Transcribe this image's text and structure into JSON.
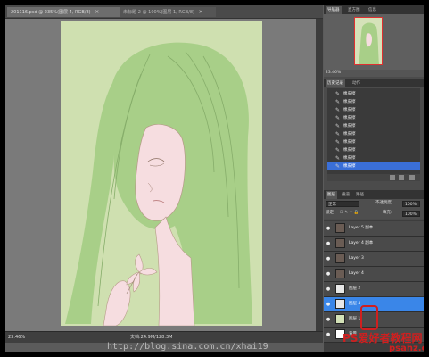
{
  "document_tabs": [
    {
      "label": "201116.psd @ 235%(图层 4, RGB/8)",
      "close": "×"
    },
    {
      "label": "未标题-2 @ 100%(图层 1, RGB/8)",
      "close": "×"
    }
  ],
  "status": {
    "zoom": "23.46%",
    "doc": "文档:24.9M/128.3M"
  },
  "navigator": {
    "tabs": [
      "导航器",
      "直方图",
      "信息"
    ],
    "zoom": "23.46%"
  },
  "history": {
    "tabs": [
      "历史记录",
      "动作"
    ],
    "items": [
      "橡皮擦",
      "橡皮擦",
      "橡皮擦",
      "橡皮擦",
      "橡皮擦",
      "橡皮擦",
      "橡皮擦",
      "橡皮擦",
      "橡皮擦",
      "橡皮擦"
    ],
    "selected_index": 9
  },
  "layers_panel": {
    "tabs": [
      "图层",
      "通道",
      "路径"
    ],
    "blend_mode": "正常",
    "opacity_label": "不透明度:",
    "opacity_value": "100%",
    "lock_label": "锁定:",
    "fill_label": "填充:",
    "fill_value": "100%",
    "layers": [
      {
        "name": "Layer 5 副本",
        "thumb": "#6a5c54"
      },
      {
        "name": "Layer 4 副本",
        "thumb": "#6a5c54"
      },
      {
        "name": "Layer 3",
        "thumb": "#6a5c54"
      },
      {
        "name": "Layer 4",
        "thumb": "#6a5c54"
      },
      {
        "name": "图层 2",
        "thumb": "#e8e8e8"
      },
      {
        "name": "图层 4",
        "thumb": "#e8e8e8"
      },
      {
        "name": "图层 1",
        "thumb": "#d4e2b8"
      },
      {
        "name": "背景",
        "thumb": "#ffffff"
      }
    ],
    "selected_index": 5
  },
  "watermark": {
    "url_text": "http://blog.sina.com.cn/xhai19",
    "brand": "PS爱好者教程网",
    "site": "psahz.com"
  },
  "colors": {
    "canvas_bg": "#cfe0b0",
    "hair_green": "#a8cf88",
    "skin": "#f6dde0",
    "selection_blue": "#3a86e8"
  }
}
